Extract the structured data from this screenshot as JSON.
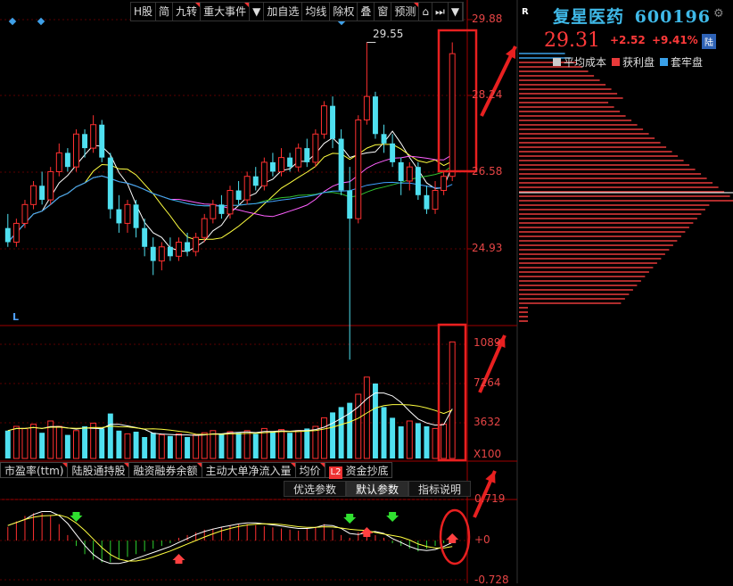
{
  "toolbar": {
    "items": [
      "H股",
      "简",
      "九转",
      "重大事件",
      "▼",
      "加自选",
      "均线",
      "除权",
      "叠",
      "窗",
      "预测",
      "⌂",
      "⏭",
      "▼"
    ]
  },
  "chart": {
    "price_ticks": [
      "29.88",
      "28.24",
      "26.58",
      "24.93"
    ],
    "high_label": "29.55",
    "volume_ticks": [
      "1089",
      "7264",
      "3632",
      "X100"
    ],
    "macd_ticks": [
      "0.719",
      "+0",
      "-0.728"
    ],
    "l_marker": "L"
  },
  "chart_data": [
    {
      "type": "candlestick",
      "title": "",
      "ylim": [
        24.0,
        30.3
      ],
      "y_ticks": [
        29.88,
        28.24,
        26.58,
        24.93
      ],
      "annotations": [
        {
          "text": "29.55",
          "value": 29.55
        }
      ],
      "series": [
        {
          "values": [
            [
              25.6,
              25.3,
              25.9,
              25.2
            ],
            [
              25.3,
              25.7,
              25.8,
              25.2
            ],
            [
              25.7,
              26.1,
              26.2,
              25.6
            ],
            [
              26.1,
              26.5,
              26.6,
              26.0
            ],
            [
              26.5,
              26.2,
              26.8,
              26.1
            ],
            [
              26.2,
              26.8,
              26.9,
              26.1
            ],
            [
              26.8,
              27.2,
              27.4,
              26.7
            ],
            [
              27.2,
              26.9,
              27.3,
              26.8
            ],
            [
              26.9,
              27.6,
              27.7,
              26.8
            ],
            [
              27.6,
              27.3,
              27.7,
              27.1
            ],
            [
              27.3,
              27.8,
              28.0,
              27.2
            ],
            [
              27.8,
              27.1,
              27.9,
              27.0
            ],
            [
              27.1,
              26.0,
              27.2,
              25.8
            ],
            [
              26.0,
              25.7,
              26.3,
              25.5
            ],
            [
              25.7,
              26.1,
              26.2,
              25.5
            ],
            [
              26.1,
              25.6,
              26.2,
              25.4
            ],
            [
              25.6,
              25.2,
              25.8,
              25.0
            ],
            [
              25.2,
              24.9,
              25.4,
              24.6
            ],
            [
              24.9,
              25.2,
              25.3,
              24.7
            ],
            [
              25.2,
              25.0,
              25.4,
              24.9
            ],
            [
              25.0,
              25.3,
              25.4,
              24.9
            ],
            [
              25.3,
              25.1,
              25.5,
              25.0
            ],
            [
              25.1,
              25.4,
              25.5,
              25.0
            ],
            [
              25.4,
              25.8,
              25.9,
              25.3
            ],
            [
              25.8,
              26.1,
              26.2,
              25.7
            ],
            [
              26.1,
              25.9,
              26.3,
              25.8
            ],
            [
              25.9,
              26.4,
              26.5,
              25.8
            ],
            [
              26.4,
              26.2,
              26.6,
              26.1
            ],
            [
              26.2,
              26.7,
              26.8,
              26.1
            ],
            [
              26.7,
              26.5,
              26.9,
              26.4
            ],
            [
              26.5,
              27.0,
              27.1,
              26.4
            ],
            [
              27.0,
              26.8,
              27.2,
              26.7
            ],
            [
              26.8,
              27.1,
              27.3,
              26.7
            ],
            [
              27.1,
              26.9,
              27.2,
              26.8
            ],
            [
              26.9,
              27.3,
              27.4,
              26.8
            ],
            [
              27.3,
              27.0,
              27.5,
              26.9
            ],
            [
              27.0,
              27.6,
              27.7,
              26.9
            ],
            [
              27.6,
              28.2,
              28.3,
              27.5
            ],
            [
              28.2,
              27.5,
              28.4,
              27.3
            ],
            [
              27.5,
              26.4,
              27.7,
              26.3
            ],
            [
              26.4,
              25.8,
              26.9,
              22.8
            ],
            [
              25.8,
              27.9,
              28.0,
              25.7
            ],
            [
              27.9,
              28.4,
              29.55,
              27.8
            ],
            [
              28.4,
              27.6,
              28.5,
              27.5
            ],
            [
              27.6,
              27.4,
              27.8,
              27.2
            ],
            [
              27.4,
              27.0,
              27.6,
              26.9
            ],
            [
              27.0,
              26.6,
              27.1,
              26.3
            ],
            [
              26.6,
              26.9,
              27.0,
              26.4
            ],
            [
              26.9,
              26.3,
              27.0,
              26.2
            ],
            [
              26.3,
              26.0,
              26.5,
              25.9
            ],
            [
              26.0,
              26.4,
              26.6,
              25.9
            ],
            [
              26.4,
              26.7,
              26.8,
              26.3
            ],
            [
              26.7,
              29.31,
              29.55,
              26.6
            ]
          ]
        }
      ]
    },
    {
      "type": "bar",
      "title": "",
      "ylim": [
        0,
        1150
      ],
      "y_ticks": [
        1089,
        7264,
        3632
      ],
      "series": [
        {
          "values": [
            260,
            300,
            280,
            320,
            240,
            350,
            300,
            220,
            260,
            300,
            330,
            280,
            420,
            260,
            230,
            250,
            200,
            240,
            220,
            210,
            230,
            200,
            220,
            240,
            260,
            230,
            250,
            240,
            260,
            230,
            280,
            250,
            270,
            240,
            260,
            280,
            300,
            380,
            430,
            480,
            520,
            600,
            760,
            700,
            480,
            380,
            300,
            350,
            330,
            300,
            280,
            320,
            1089
          ]
        }
      ]
    },
    {
      "type": "bar",
      "title": "",
      "ylim": [
        -0.728,
        0.719
      ],
      "y_ticks": [
        0.719,
        0,
        -0.728
      ],
      "series": [
        {
          "values": [
            0.25,
            0.35,
            0.45,
            0.5,
            0.5,
            0.45,
            0.3,
            0.1,
            -0.1,
            -0.25,
            -0.35,
            -0.4,
            -0.4,
            -0.35,
            -0.3,
            -0.25,
            -0.2,
            -0.15,
            -0.1,
            -0.05,
            0.05,
            0.1,
            0.15,
            0.2,
            0.22,
            0.25,
            0.28,
            0.3,
            0.3,
            0.28,
            0.26,
            0.24,
            0.22,
            0.2,
            0.18,
            0.22,
            0.25,
            0.3,
            0.2,
            0.1,
            0.05,
            0.15,
            0.2,
            0.1,
            0.05,
            -0.05,
            -0.1,
            -0.15,
            -0.2,
            -0.15,
            -0.1,
            -0.05,
            0.05
          ]
        }
      ]
    }
  ],
  "tabs": [
    {
      "label": "市盈率(ttm)",
      "flag": true
    },
    {
      "label": "陆股通持股",
      "flag": true
    },
    {
      "label": "融资融券余额",
      "flag": true
    },
    {
      "label": "主动大单净流入量",
      "flag": true
    },
    {
      "label": "均价",
      "flag": true
    },
    {
      "label": "资金抄底",
      "flag": false,
      "badge": "L2"
    }
  ],
  "subtabs": [
    "优选参数",
    "默认参数",
    "指标说明"
  ],
  "right_panel": {
    "marker": "R",
    "stock_name": "复星医药",
    "stock_code": "600196",
    "price": "29.31",
    "change": "+2.52",
    "change_pct": "+9.41%",
    "badge": "陆",
    "legend": [
      {
        "label": "平均成本",
        "color": "#cccccc"
      },
      {
        "label": "获利盘",
        "color": "#e83a3a"
      },
      {
        "label": "套牢盘",
        "color": "#3aa0e8"
      }
    ]
  },
  "colors": {
    "up": "#ff3030",
    "down": "#4fe0f0",
    "annotation": "#e82020",
    "axis": "#a00000",
    "ma5": "#ffffff",
    "ma10": "#ffff40",
    "ma20": "#ff60ff",
    "ma30": "#30c030",
    "ma60": "#40a0ff"
  }
}
